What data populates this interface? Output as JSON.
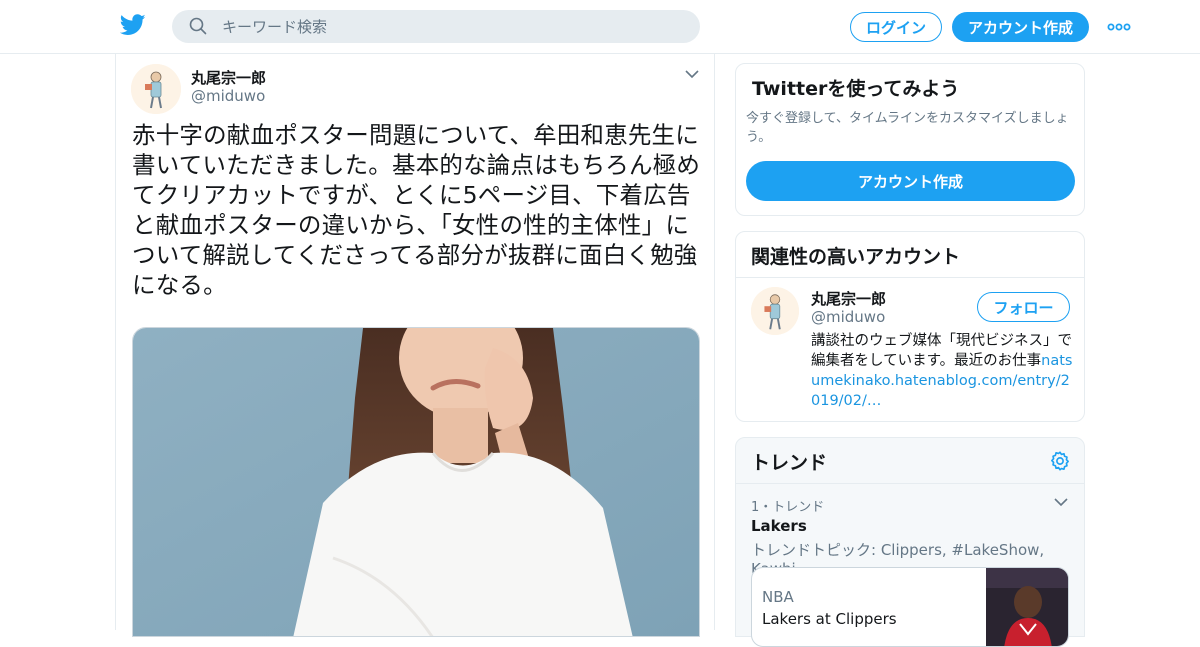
{
  "header": {
    "search_placeholder": "キーワード検索",
    "login_label": "ログイン",
    "signup_label": "アカウント作成"
  },
  "tweet": {
    "author_name": "丸尾宗一郎",
    "author_handle": "@miduwo",
    "text": "赤十字の献血ポスター問題について、牟田和恵先生に書いていただきました。基本的な論点はもちろん極めてクリアカットですが、とくに5ページ目、下着広告と献血ポスターの違いから、「女性の性的主体性」について解説してくださってる部分が抜群に面白く勉強になる。"
  },
  "try_twitter": {
    "title": "Twitterを使ってみよう",
    "description": "今すぐ登録して、タイムラインをカスタマイズしましょう。",
    "cta_label": "アカウント作成"
  },
  "related": {
    "title": "関連性の高いアカウント",
    "name": "丸尾宗一郎",
    "handle": "@miduwo",
    "follow_label": "フォロー",
    "bio_text": "講談社のウェブ媒体「現代ビジネス」で編集者をしています。最近のお仕事",
    "bio_link": "natsumekinako.hatenablog.com/entry/2019/02/…"
  },
  "trends": {
    "title": "トレンド",
    "rank_label": "1・トレンド",
    "trend_name": "Lakers",
    "trend_topic": "トレンドトピック: Clippers, #LakeShow, Kawhi",
    "news_category": "NBA",
    "news_headline": "Lakers at Clippers"
  },
  "colors": {
    "accent": "#1da1f2",
    "link": "#1b95e0",
    "border": "#e6ecf0",
    "muted": "#657786"
  },
  "icons": [
    "twitter-bird-icon",
    "search-icon",
    "more-icon",
    "chevron-down-icon",
    "gear-icon"
  ]
}
